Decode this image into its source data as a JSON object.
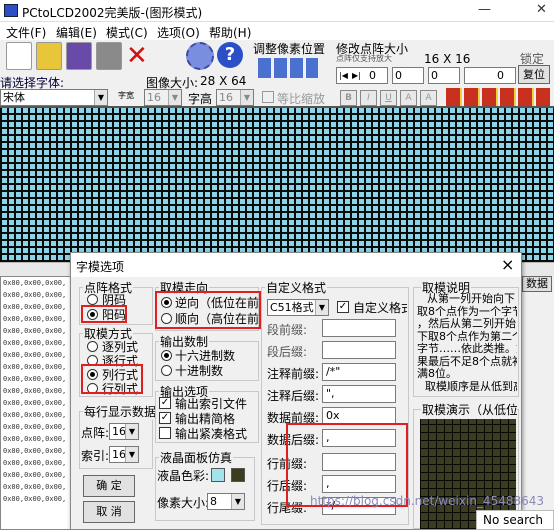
{
  "window": {
    "title": "PCtoLCD2002完美版-(图形模式)"
  },
  "menu": [
    "文件(F)",
    "编辑(E)",
    "模式(C)",
    "选项(O)",
    "帮助(H)"
  ],
  "toolbar": {
    "font_label": "请选择字体:",
    "font_value": "宋体",
    "size_prefix": "字宽",
    "size_value": "16",
    "height_label": "字高",
    "height_value": "16",
    "ratio_label": "等比缩放",
    "image_size_label": "图像大小:",
    "image_size_value": "28 X 64",
    "adjust_label": "调整像素位置",
    "modify_label": "修改点阵大小",
    "modify_hint": "点阵仅支持放大",
    "modify_value": "16 X 16",
    "spin_value": "0",
    "lock_label": "锁定",
    "reset_label": "复位",
    "data_label": "数据",
    "style_buttons": [
      "B",
      "I",
      "U",
      "A",
      "A"
    ]
  },
  "output_lines": [
    "0x00,0x00,0x00,",
    "0x00,0x00,0x00,",
    "0x00,0x00,0x00,",
    "0x00,0x00,0x00,",
    "0x00,0x00,0x00,",
    "0x00,0x00,0x00,",
    "0x00,0x00,0x00,",
    "0x00,0x00,0x00,",
    "0x00,0x00,0x00,",
    "0x00,0x00,0x00,",
    "0x00,0x00,0x00,",
    "0x00,0x00,0x00,",
    "0x00,0x00,0x00,",
    "0x00,0x00,0x00,",
    "0x00,0x00,0x00,",
    "0x00,0x00,0x00,",
    "0x00,0x00,0x00,",
    "0x00,0x00,0x00,",
    "0x00,0x00,0x00,"
  ],
  "dialog": {
    "title": "字模选项",
    "close": "×",
    "dot_format": {
      "title": "点阵格式",
      "options": [
        "阴码",
        "阳码"
      ],
      "selected": 1
    },
    "mode": {
      "title": "取模方式",
      "options": [
        "逐列式",
        "逐行式",
        "列行式",
        "行列式"
      ],
      "selected": 2
    },
    "direction": {
      "title": "取模走向",
      "options": [
        "逆向（低位在前",
        "顺向（高位在前"
      ],
      "selected": 0
    },
    "radix": {
      "title": "输出数制",
      "options": [
        "十六进制数",
        "十进制数"
      ],
      "selected": 0
    },
    "output_opts": {
      "title": "输出选项",
      "options": [
        "输出索引文件",
        "输出精简格",
        "输出紧凑格式"
      ],
      "checked": [
        true,
        true,
        false
      ]
    },
    "per_line": {
      "title": "每行显示数据",
      "dot_label": "点阵:",
      "dot_value": "16",
      "index_label": "索引:",
      "index_value": "16"
    },
    "lcd": {
      "title": "液晶面板仿真",
      "color_label": "液晶色彩:",
      "pixel_label": "像素大小:",
      "pixel_value": "8",
      "color1": "#a3e4ec",
      "color2": "#3c3c1e"
    },
    "custom": {
      "title": "自定义格式",
      "format_value": "C51格式",
      "checkbox_label": "自定义格式",
      "fields": [
        {
          "label": "段前缀:",
          "value": ""
        },
        {
          "label": "段后缀:",
          "value": ""
        },
        {
          "label": "注释前缀:",
          "value": "/*\""
        },
        {
          "label": "注释后缀:",
          "value": "\","
        },
        {
          "label": "数据前缀:",
          "value": "0x"
        },
        {
          "label": "数据后缀:",
          "value": ","
        },
        {
          "label": "行前缀:",
          "value": ""
        },
        {
          "label": "行后缀:",
          "value": ","
        },
        {
          "label": "行尾缀:",
          "value": "*/"
        }
      ]
    },
    "explain": {
      "title": "取模说明",
      "lines": [
        "从第一列开始向下",
        "取8个点作为一个字节",
        "，然后从第二列开始向",
        "下取8个点作为第二个",
        "字节……依此类推。如",
        "果最后不足8个点就补",
        "满8位。",
        "取模顺序是从低到高"
      ]
    },
    "demo_title": "取模演示（从低位到",
    "ok_label": "确 定",
    "cancel_label": "取 消"
  },
  "watermark": "https://blog.csdn.net/weixin_45488643",
  "status": "No search"
}
